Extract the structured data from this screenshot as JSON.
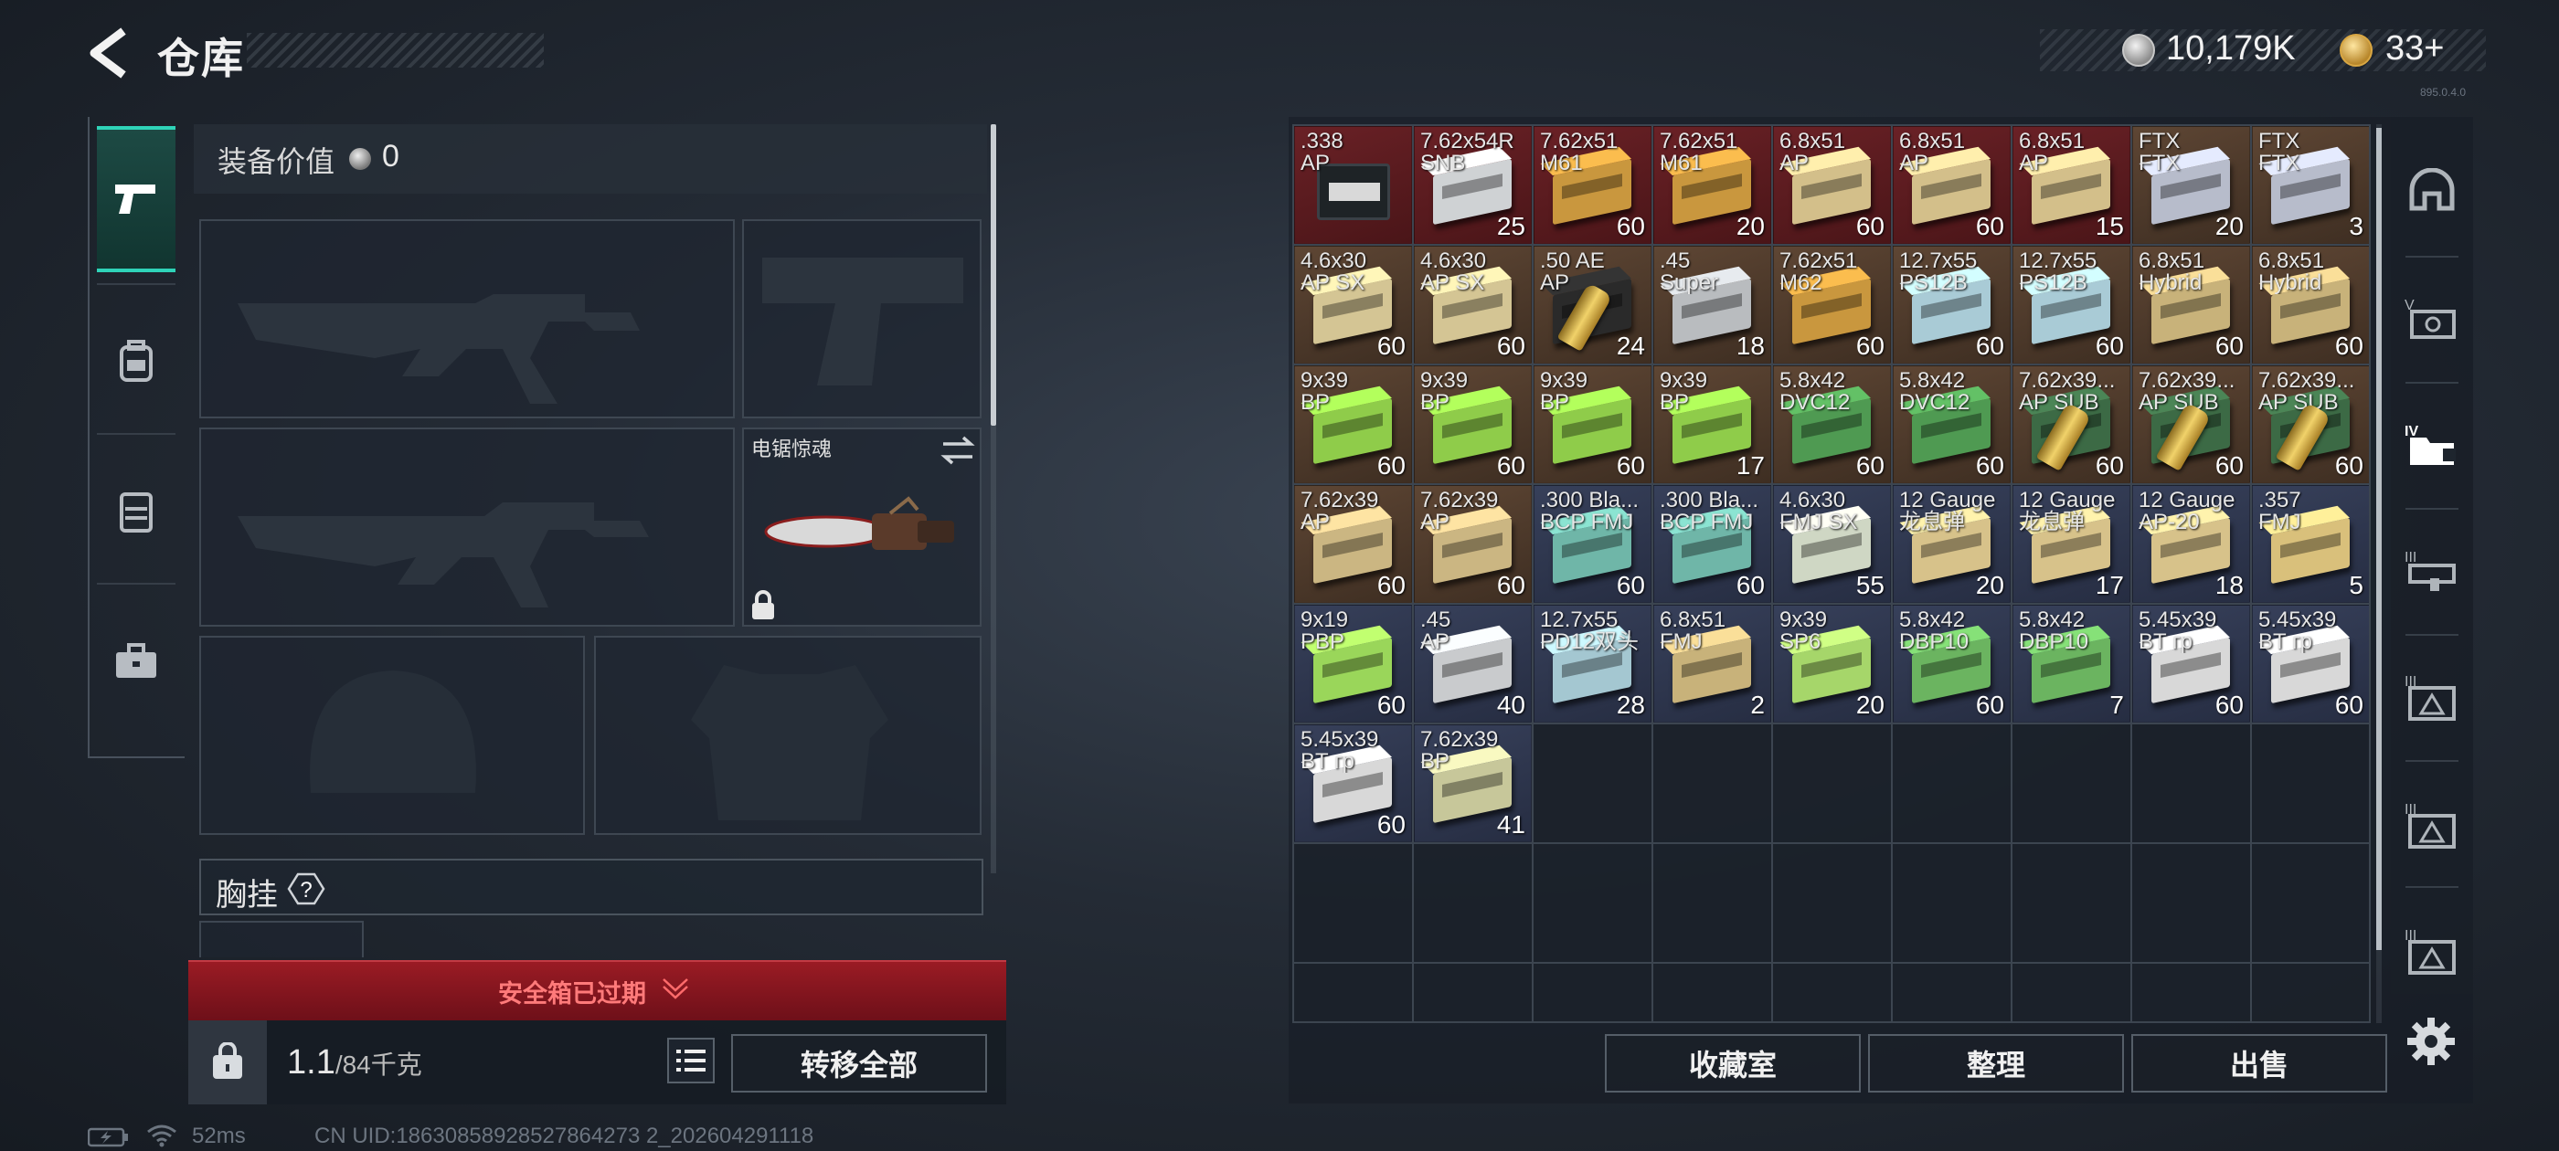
{
  "header": {
    "title": "仓库",
    "currency_silver": "10,179K",
    "currency_gold": "33+",
    "version": "895.0.4.0"
  },
  "left_nav": [
    "pistol-icon",
    "backpack-icon",
    "rig-icon",
    "toolbox-icon"
  ],
  "equipment": {
    "value_label": "装备价值",
    "value": "0",
    "melee_name": "电锯惊魂",
    "vest_label": "胸挂",
    "vest_help": "?",
    "safebox_text": "安全箱已过期",
    "weight_current": "1.1",
    "weight_capacity": "/84千克",
    "transfer_all": "转移全部"
  },
  "status": {
    "ping": "52ms",
    "uid": "CN UID:18630858928527864273 2_202604291118"
  },
  "stash": {
    "buttons": {
      "collection": "收藏室",
      "organize": "整理",
      "sell": "出售"
    },
    "items": [
      {
        "name": ".338\nAP",
        "count": "",
        "bg": "red",
        "icon": "crate",
        "color": "#2a2e30"
      },
      {
        "name": "7.62x54R\nSNB",
        "count": "25",
        "bg": "red",
        "icon": "box",
        "color": "#cfd2d4"
      },
      {
        "name": "7.62x51\nM61",
        "count": "60",
        "bg": "red",
        "icon": "box",
        "color": "#c9973e"
      },
      {
        "name": "7.62x51\nM61",
        "count": "20",
        "bg": "red",
        "icon": "box",
        "color": "#c9973e"
      },
      {
        "name": "6.8x51\nAP",
        "count": "60",
        "bg": "red",
        "icon": "box",
        "color": "#d3bf8a"
      },
      {
        "name": "6.8x51\nAP",
        "count": "60",
        "bg": "red",
        "icon": "box",
        "color": "#d3bf8a"
      },
      {
        "name": "6.8x51\nAP",
        "count": "15",
        "bg": "red",
        "icon": "box",
        "color": "#d3bf8a"
      },
      {
        "name": "FTX\nFTX",
        "count": "20",
        "bg": "brown",
        "icon": "box",
        "color": "#b7bccb"
      },
      {
        "name": "FTX\nFTX",
        "count": "3",
        "bg": "brown",
        "icon": "box",
        "color": "#b7bccb"
      },
      {
        "name": "4.6x30\nAP SX",
        "count": "60",
        "bg": "brown",
        "icon": "box",
        "color": "#d4c594"
      },
      {
        "name": "4.6x30\nAP SX",
        "count": "60",
        "bg": "brown",
        "icon": "box",
        "color": "#d4c594"
      },
      {
        "name": ".50 AE\nAP",
        "count": "24",
        "bg": "brown",
        "icon": "cartridge",
        "color": "#2a2a2a"
      },
      {
        "name": ".45\nSuper",
        "count": "18",
        "bg": "brown",
        "icon": "box",
        "color": "#b9bcbf"
      },
      {
        "name": "7.62x51\nM62",
        "count": "60",
        "bg": "brown",
        "icon": "box",
        "color": "#c9973e"
      },
      {
        "name": "12.7x55\nPS12B",
        "count": "60",
        "bg": "brown",
        "icon": "box",
        "color": "#a9cbd6"
      },
      {
        "name": "12.7x55\nPS12B",
        "count": "60",
        "bg": "brown",
        "icon": "box",
        "color": "#a9cbd6"
      },
      {
        "name": "6.8x51\nHybrid",
        "count": "60",
        "bg": "brown",
        "icon": "box",
        "color": "#c8b27a"
      },
      {
        "name": "6.8x51\nHybrid",
        "count": "60",
        "bg": "brown",
        "icon": "box",
        "color": "#c8b27a"
      },
      {
        "name": "9x39\nBP",
        "count": "60",
        "bg": "brown",
        "icon": "box",
        "color": "#8fcc4a"
      },
      {
        "name": "9x39\nBP",
        "count": "60",
        "bg": "brown",
        "icon": "box",
        "color": "#8fcc4a"
      },
      {
        "name": "9x39\nBP",
        "count": "60",
        "bg": "brown",
        "icon": "box",
        "color": "#8fcc4a"
      },
      {
        "name": "9x39\nBP",
        "count": "17",
        "bg": "brown",
        "icon": "box",
        "color": "#8fcc4a"
      },
      {
        "name": "5.8x42\nDVC12",
        "count": "60",
        "bg": "brown",
        "icon": "box",
        "color": "#4f9a52"
      },
      {
        "name": "5.8x42\nDVC12",
        "count": "60",
        "bg": "brown",
        "icon": "box",
        "color": "#4f9a52"
      },
      {
        "name": "7.62x39...\nAP SUB",
        "count": "60",
        "bg": "brown",
        "icon": "cartridge",
        "color": "#3c6a45"
      },
      {
        "name": "7.62x39...\nAP SUB",
        "count": "60",
        "bg": "brown",
        "icon": "cartridge",
        "color": "#3c6a45"
      },
      {
        "name": "7.62x39...\nAP SUB",
        "count": "60",
        "bg": "brown",
        "icon": "cartridge",
        "color": "#3c6a45"
      },
      {
        "name": "7.62x39\nAP",
        "count": "60",
        "bg": "brown",
        "icon": "box",
        "color": "#cbb682"
      },
      {
        "name": "7.62x39\nAP",
        "count": "60",
        "bg": "brown",
        "icon": "box",
        "color": "#cbb682"
      },
      {
        "name": ".300 Bla...\nBCP FMJ",
        "count": "60",
        "bg": "blue",
        "icon": "box",
        "color": "#6fb6a8"
      },
      {
        "name": ".300 Bla...\nBCP FMJ",
        "count": "60",
        "bg": "blue",
        "icon": "box",
        "color": "#6fb6a8"
      },
      {
        "name": "4.6x30\nFMJ SX",
        "count": "55",
        "bg": "blue",
        "icon": "box",
        "color": "#cfd7c4"
      },
      {
        "name": "12 Gauge\n龙息弹",
        "count": "20",
        "bg": "blue",
        "icon": "box",
        "color": "#d7c28a"
      },
      {
        "name": "12 Gauge\n龙息弹",
        "count": "17",
        "bg": "blue",
        "icon": "box",
        "color": "#d7c28a"
      },
      {
        "name": "12 Gauge\nAP-20",
        "count": "18",
        "bg": "blue",
        "icon": "box",
        "color": "#d7c28a"
      },
      {
        "name": ".357\nFMJ",
        "count": "5",
        "bg": "blue",
        "icon": "box",
        "color": "#d9c07b"
      },
      {
        "name": "9x19\nPBP",
        "count": "60",
        "bg": "blue",
        "icon": "box",
        "color": "#9ad65a"
      },
      {
        "name": ".45\nAP",
        "count": "40",
        "bg": "blue",
        "icon": "box",
        "color": "#c9cbcd"
      },
      {
        "name": "12.7x55\nPD12双头",
        "count": "28",
        "bg": "blue",
        "icon": "box",
        "color": "#a4c7d1"
      },
      {
        "name": "6.8x51\nFMJ",
        "count": "2",
        "bg": "blue",
        "icon": "box",
        "color": "#c8b27a"
      },
      {
        "name": "9x39\nSP6",
        "count": "20",
        "bg": "blue",
        "icon": "box",
        "color": "#a6d66a"
      },
      {
        "name": "5.8x42\nDBP10",
        "count": "60",
        "bg": "blue",
        "icon": "box",
        "color": "#6bb460"
      },
      {
        "name": "5.8x42\nDBP10",
        "count": "7",
        "bg": "blue",
        "icon": "box",
        "color": "#6bb460"
      },
      {
        "name": "5.45x39\nBT гр",
        "count": "60",
        "bg": "blue",
        "icon": "box",
        "color": "#d8d8d8"
      },
      {
        "name": "5.45x39\nBT гр",
        "count": "60",
        "bg": "blue",
        "icon": "box",
        "color": "#d8d8d8"
      },
      {
        "name": "5.45x39\nBT гр",
        "count": "60",
        "bg": "blue",
        "icon": "box",
        "color": "#d8d8d8"
      },
      {
        "name": "7.62x39\nBP",
        "count": "41",
        "bg": "blue",
        "icon": "box",
        "color": "#c7c79a"
      }
    ]
  },
  "right_tabs": [
    "helmet-icon",
    "tier-v-icon",
    "tier-iv-folder-icon",
    "tier-iii-icon",
    "tier-iii-a-icon",
    "tier-iii-b-icon",
    "tier-iii-c-icon",
    "tier-iii-d-icon"
  ]
}
